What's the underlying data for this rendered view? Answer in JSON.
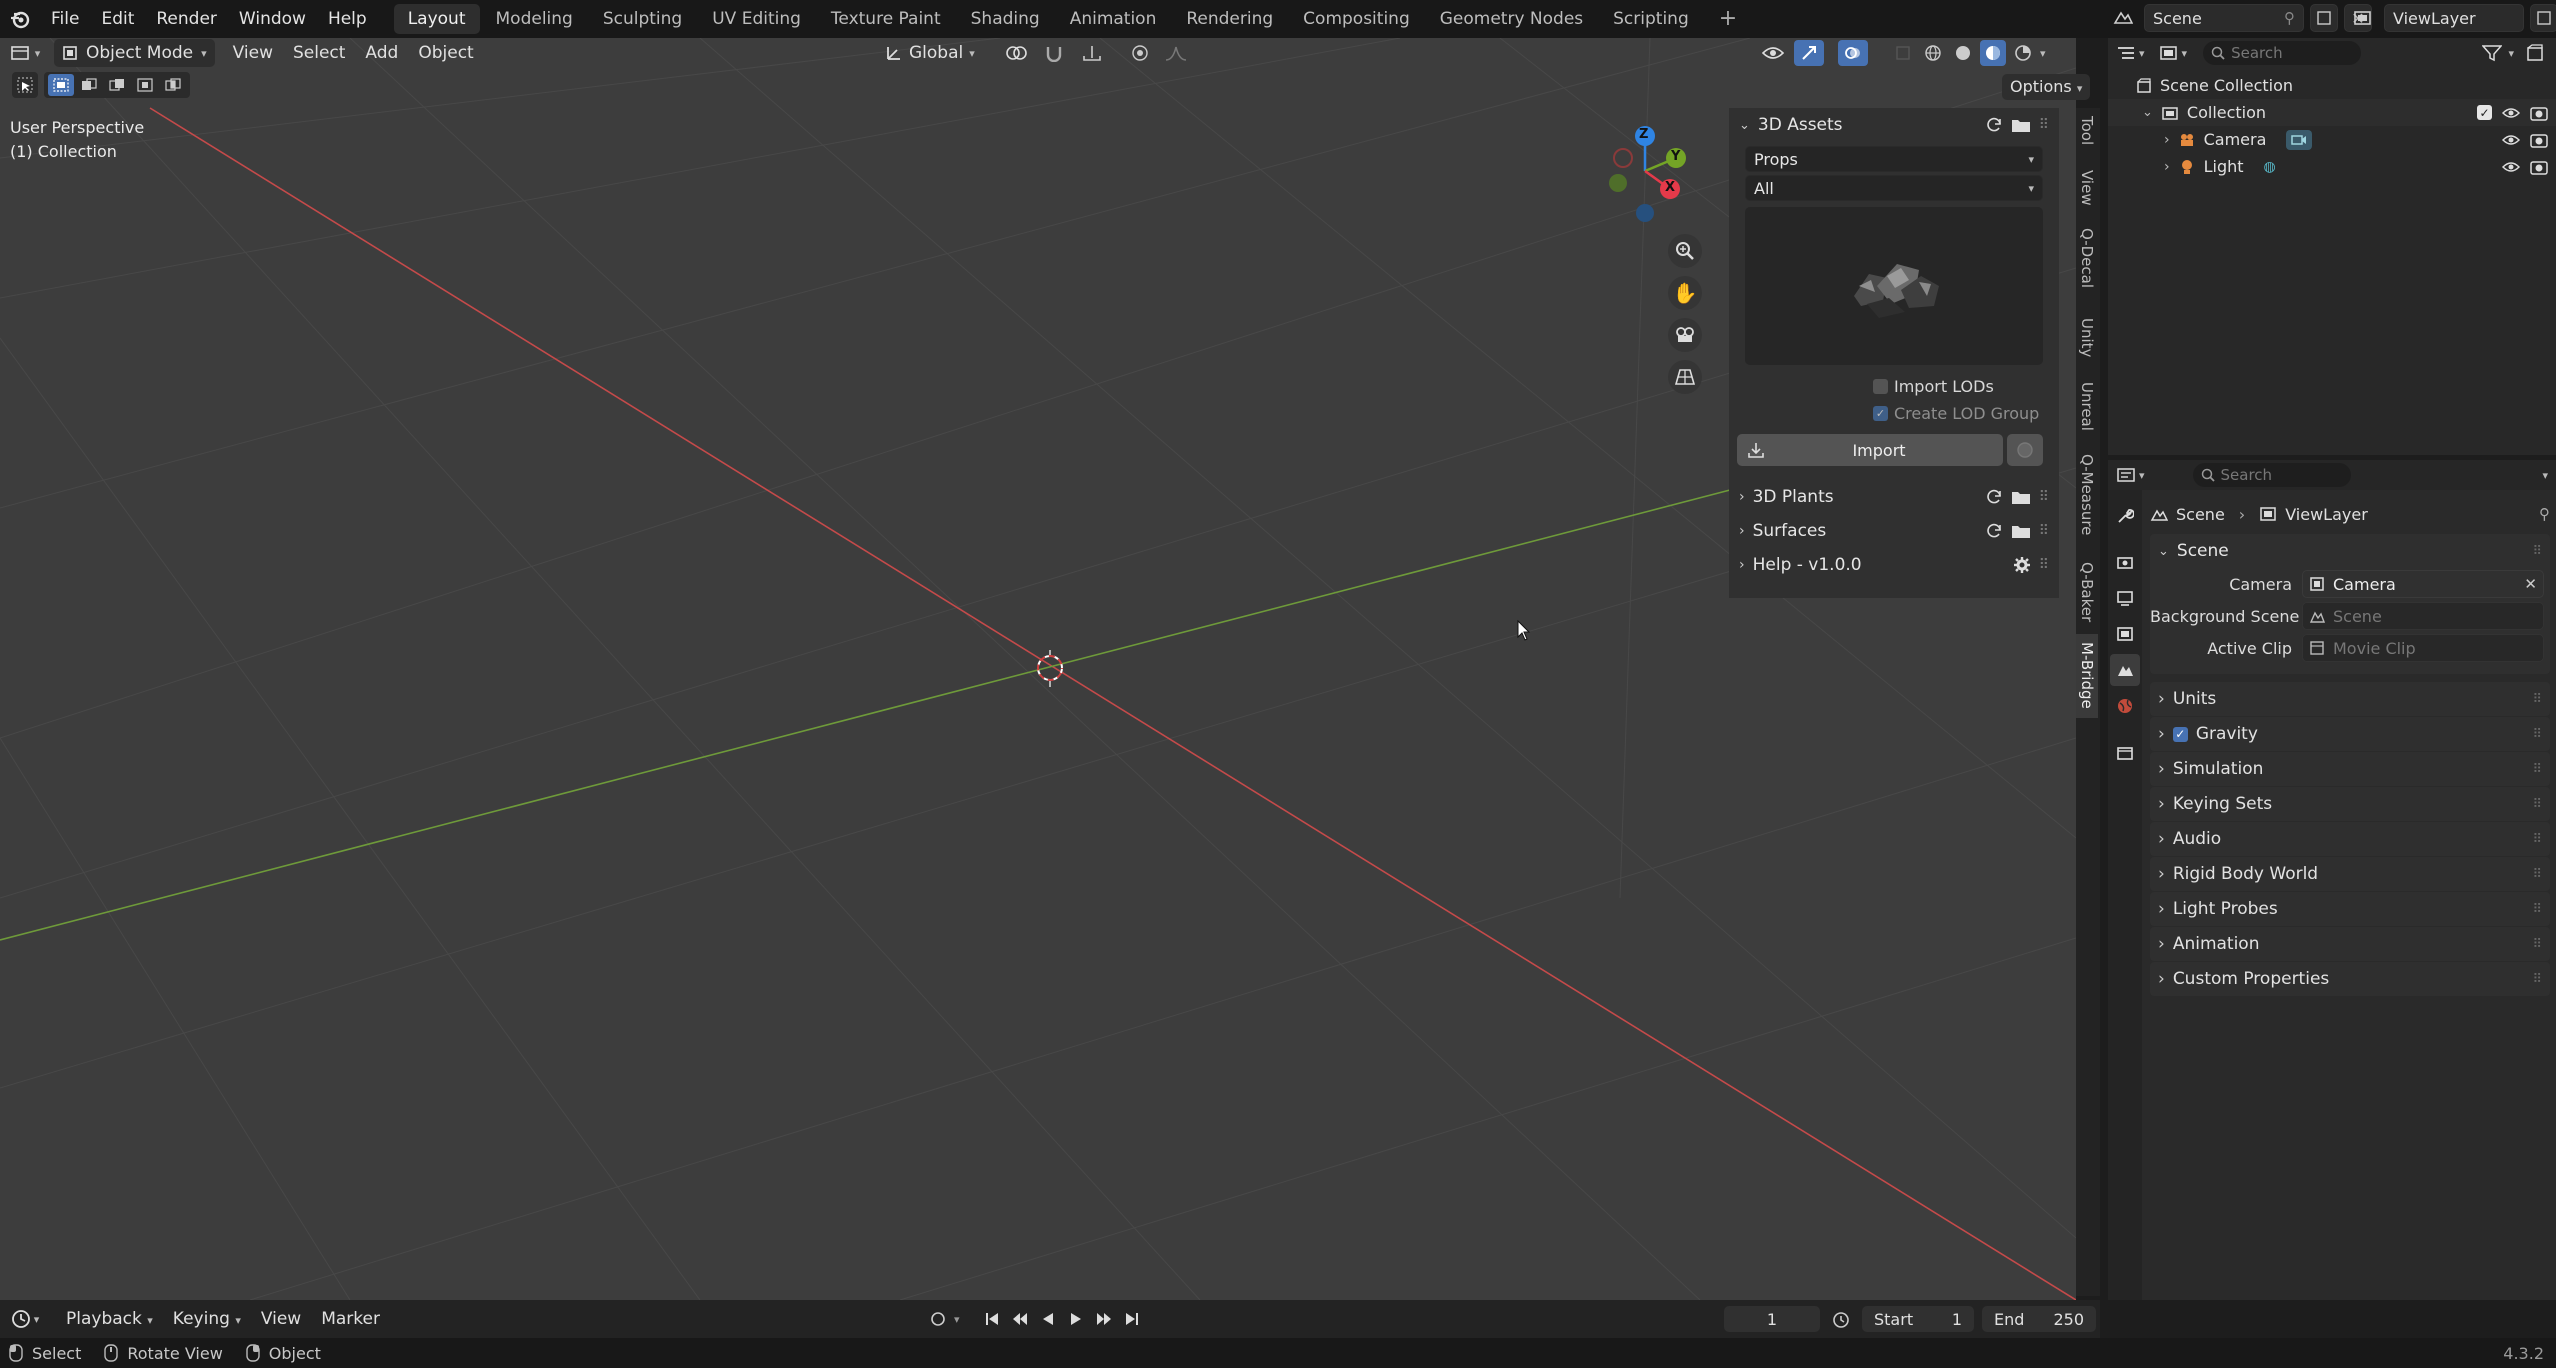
{
  "topbar": {
    "menus": [
      "File",
      "Edit",
      "Render",
      "Window",
      "Help"
    ],
    "workspaces": [
      "Layout",
      "Modeling",
      "Sculpting",
      "UV Editing",
      "Texture Paint",
      "Shading",
      "Animation",
      "Rendering",
      "Compositing",
      "Geometry Nodes",
      "Scripting"
    ],
    "active_workspace": "Layout",
    "scene_name": "Scene",
    "view_layer": "ViewLayer"
  },
  "viewport_header": {
    "mode": "Object Mode",
    "menus": [
      "View",
      "Select",
      "Add",
      "Object"
    ],
    "orientation": "Global",
    "options_label": "Options"
  },
  "viewport": {
    "perspective": "User Perspective",
    "collection": "(1) Collection",
    "gizmo_axes": [
      "Z",
      "Y",
      "X"
    ]
  },
  "npanel": {
    "section_title": "3D Assets",
    "category": "Props",
    "filter": "All",
    "import_lods": "Import LODs",
    "create_lod_group": "Create LOD Group",
    "import_button": "Import",
    "sections": [
      "3D Plants",
      "Surfaces"
    ],
    "help": "Help - v1.0.0"
  },
  "sidetabs": [
    "Tool",
    "View",
    "Q-Decal",
    "Unity",
    "Unreal",
    "Q-Measure",
    "Q-Baker",
    "M-Bridge"
  ],
  "active_sidetab": "M-Bridge",
  "outliner": {
    "search_placeholder": "Search",
    "root": "Scene Collection",
    "collection": "Collection",
    "items": [
      "Camera",
      "Light"
    ]
  },
  "properties": {
    "search_placeholder": "Search",
    "breadcrumb": [
      "Scene",
      "ViewLayer"
    ],
    "panel_title": "Scene",
    "camera_label": "Camera",
    "camera_value": "Camera",
    "bg_scene_label": "Background Scene",
    "bg_scene_placeholder": "Scene",
    "active_clip_label": "Active Clip",
    "active_clip_placeholder": "Movie Clip",
    "subpanels": [
      "Units",
      "Gravity",
      "Simulation",
      "Keying Sets",
      "Audio",
      "Rigid Body World",
      "Light Probes",
      "Animation",
      "Custom Properties"
    ],
    "gravity_checked": true
  },
  "timeline": {
    "menus": [
      "Playback",
      "Keying",
      "View",
      "Marker"
    ],
    "current_frame": "1",
    "start_label": "Start",
    "start_value": "1",
    "end_label": "End",
    "end_value": "250"
  },
  "statusbar": {
    "items": [
      "Select",
      "Rotate View",
      "Object"
    ],
    "version": "4.3.2"
  },
  "colors": {
    "accent": "#4772b3",
    "x_axis": "#c44a4a",
    "y_axis": "#6e9a3a",
    "viewport_bg": "#3d3d3d",
    "gizmo_x": "#e43a4a",
    "gizmo_y": "#74a426",
    "gizmo_z": "#2f84e3"
  }
}
